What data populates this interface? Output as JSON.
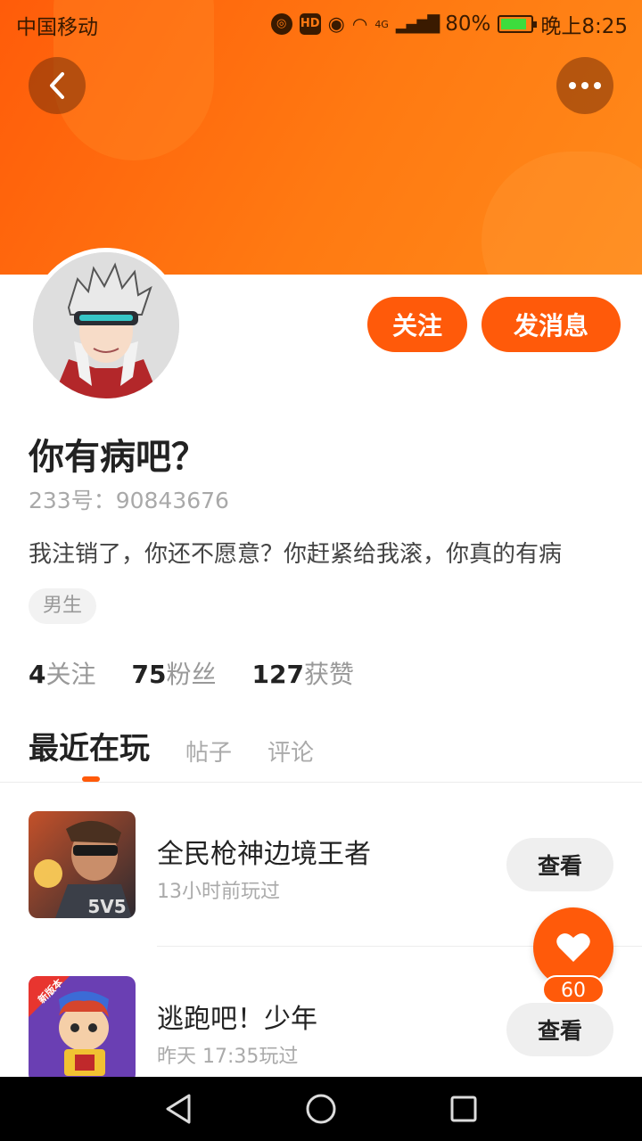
{
  "status_bar": {
    "carrier": "中国移动",
    "network": "4G",
    "battery": "80%",
    "time": "晚上8:25"
  },
  "header": {
    "back_icon": "chevron-left-icon",
    "more_icon": "more-dots-icon",
    "accent_color": "#ff7a12"
  },
  "profile": {
    "follow_label": "关注",
    "message_label": "发消息",
    "nickname": "你有病吧？",
    "uid_label": "233号：",
    "uid": "90843676",
    "bio": "我注销了，你还不愿意？你赶紧给我滚，你真的有病",
    "gender": "男生"
  },
  "stats": [
    {
      "value": "4",
      "label": "关注"
    },
    {
      "value": "75",
      "label": "粉丝"
    },
    {
      "value": "127",
      "label": "获赞"
    }
  ],
  "tabs": [
    {
      "label": "最近在玩",
      "active": true
    },
    {
      "label": "帖子",
      "active": false
    },
    {
      "label": "评论",
      "active": false
    }
  ],
  "games": [
    {
      "name": "全民枪神边境王者",
      "meta": "13小时前玩过",
      "action": "查看",
      "thumb_badge": "5V5"
    },
    {
      "name": "逃跑吧！少年",
      "meta": "昨天 17:35玩过",
      "action": "查看",
      "thumb_badge": "新版本"
    }
  ],
  "like": {
    "count": "60",
    "icon": "heart-icon"
  },
  "nav": {
    "back_icon": "nav-back-icon",
    "home_icon": "nav-home-icon",
    "recents_icon": "nav-recents-icon"
  }
}
